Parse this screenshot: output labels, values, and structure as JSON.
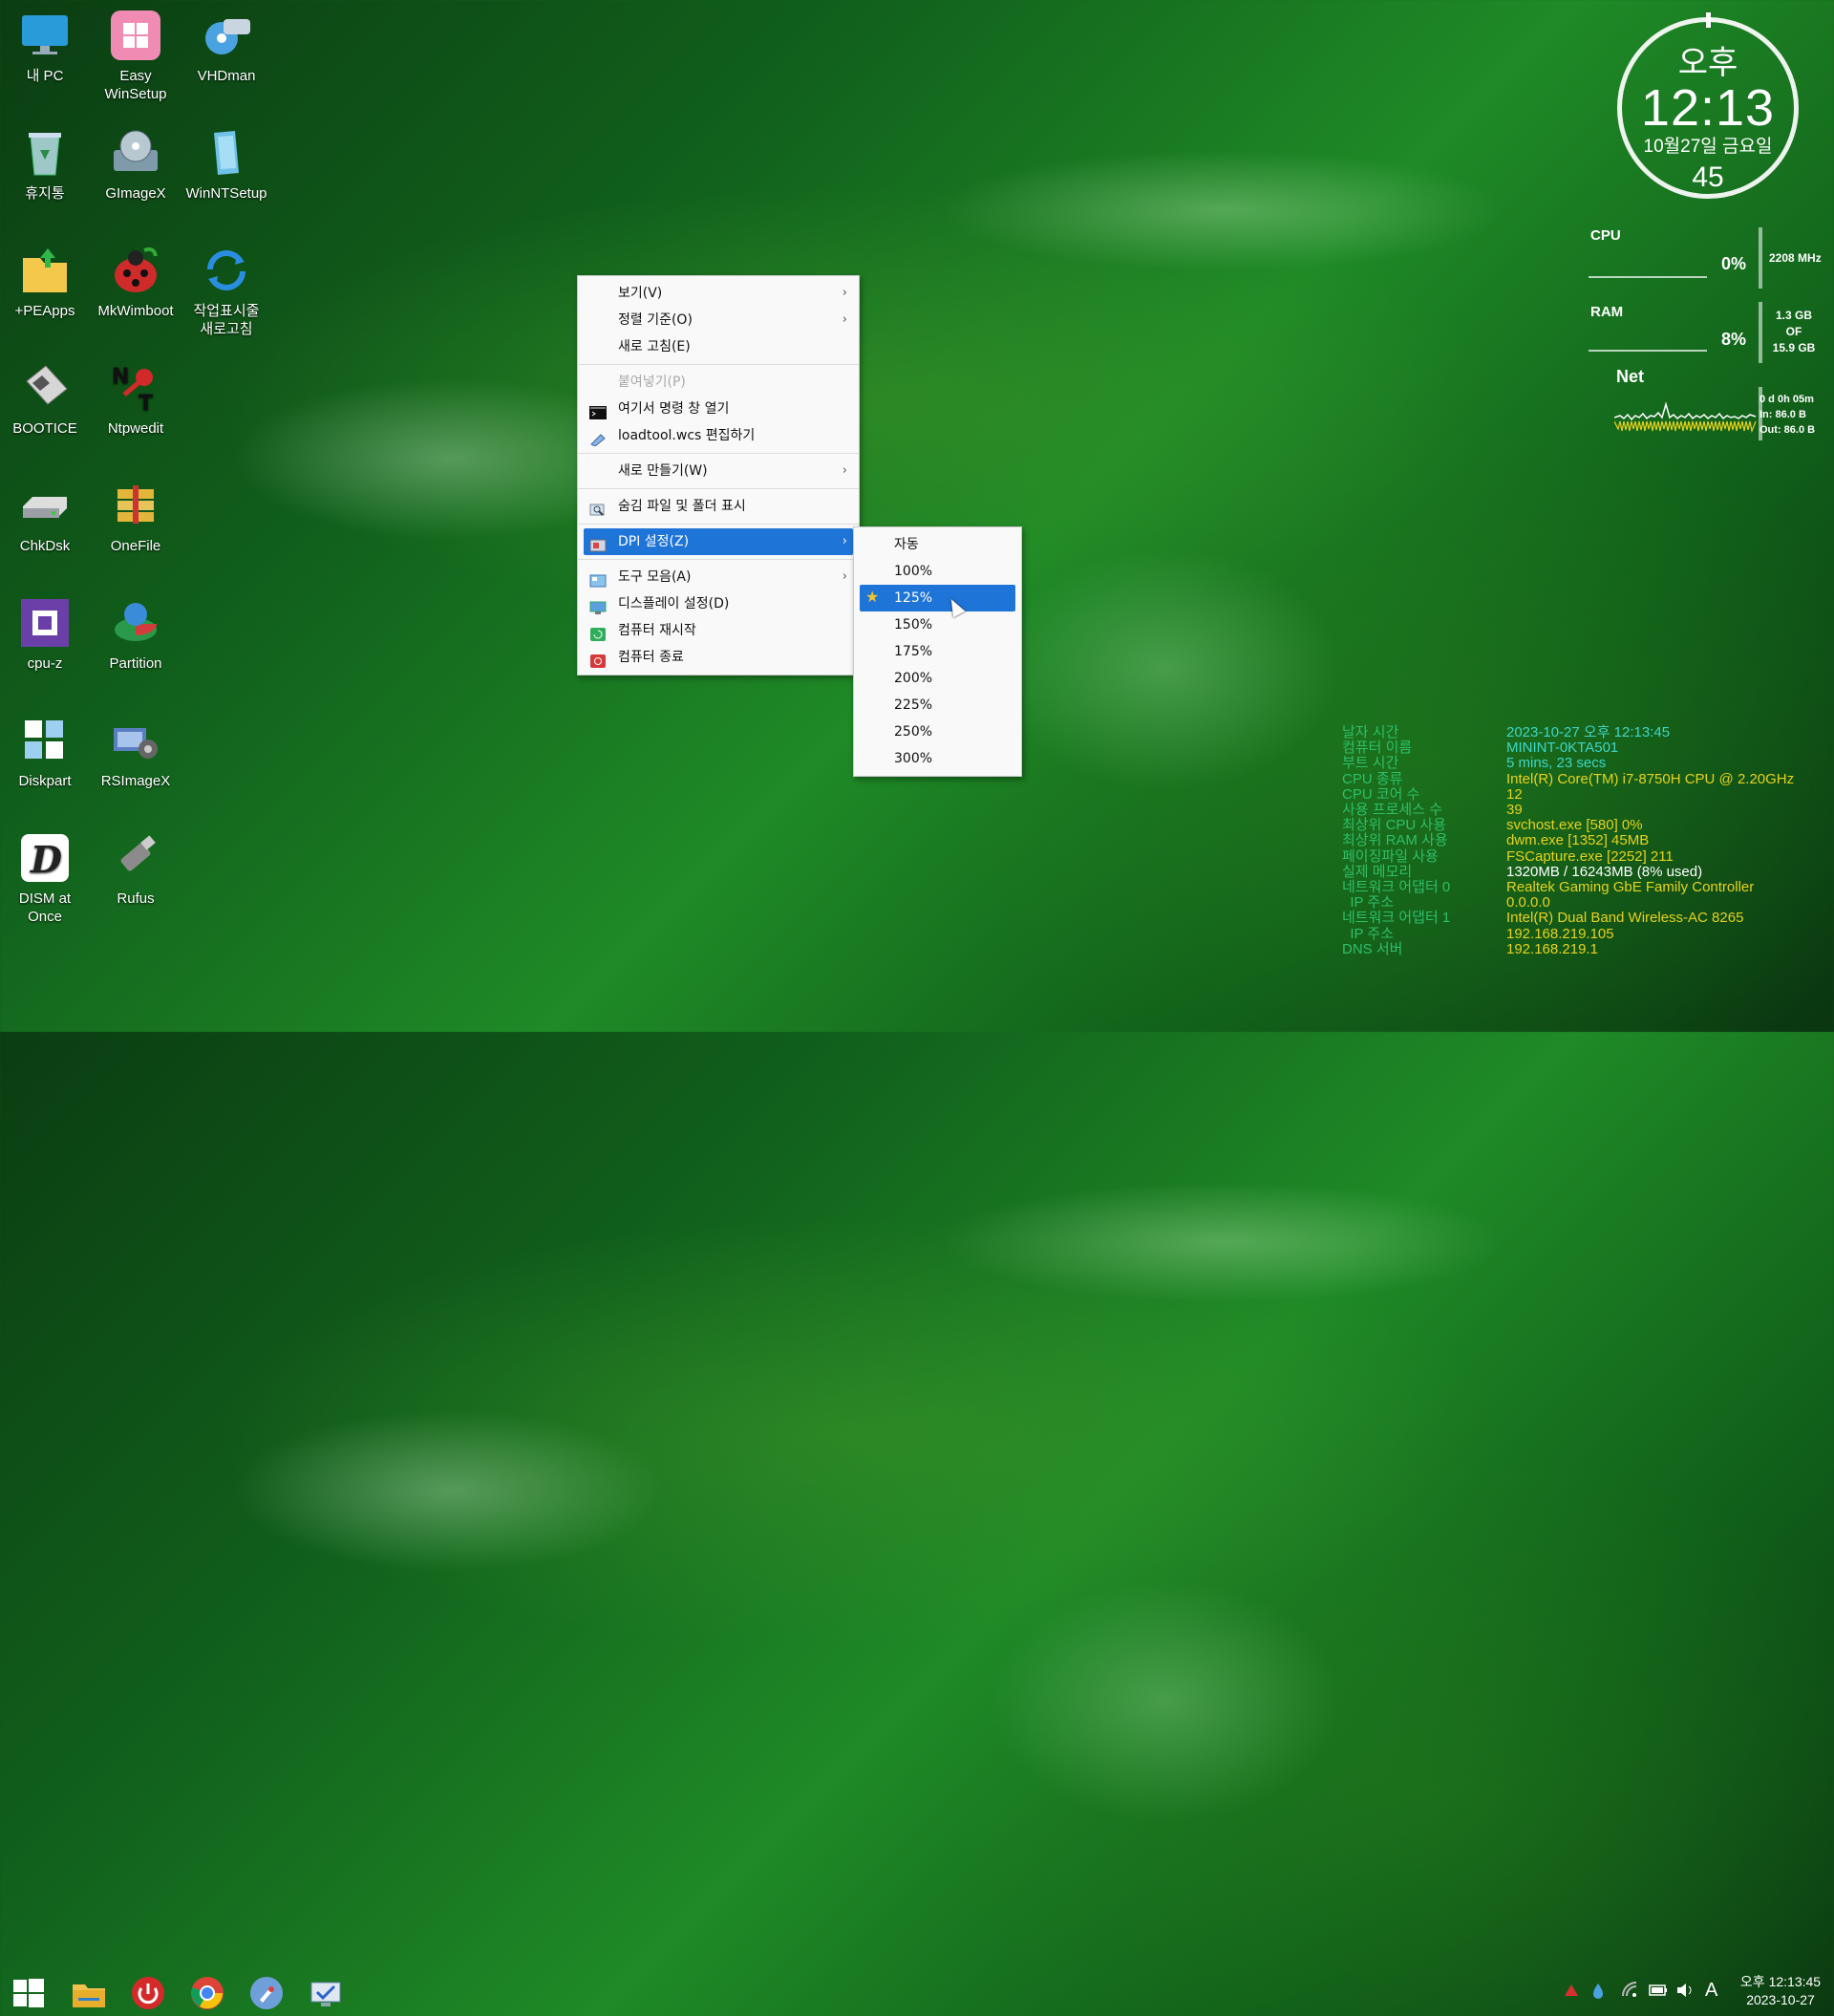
{
  "desktop_icons": [
    {
      "label": "내 PC",
      "icon": "monitor-icon",
      "color": "#2a9bd9"
    },
    {
      "label": "Easy\nWinSetup",
      "icon": "windows-pink-icon",
      "color": "#f08cb4"
    },
    {
      "label": "VHDman",
      "icon": "vhd-drive-icon",
      "color": "#4aa3e0"
    },
    {
      "label": "휴지통",
      "icon": "recycle-bin-icon",
      "color": "#9ec7c7"
    },
    {
      "label": "GImageX",
      "icon": "gimagex-icon",
      "color": "#7f9aa8"
    },
    {
      "label": "WinNTSetup",
      "icon": "winntsetup-icon",
      "color": "#6fc2e8"
    },
    {
      "label": "+PEApps",
      "icon": "folder-icon",
      "color": "#f3c84b"
    },
    {
      "label": "MkWimboot",
      "icon": "ladybug-icon",
      "color": "#cf2b2b"
    },
    {
      "label": "작업표시줄\n새로고침",
      "icon": "refresh-icon",
      "color": "#2a8ee0"
    },
    {
      "label": "BOOTICE",
      "icon": "floppy-icon",
      "color": "#d6d6d6"
    },
    {
      "label": "Ntpwedit",
      "icon": "key-icon",
      "color": "#d22a2a"
    },
    {
      "label": "ChkDsk",
      "icon": "disk-drive-icon",
      "color": "#9aa0a6"
    },
    {
      "label": "OneFile",
      "icon": "archive-icon",
      "color": "#e3b53a"
    },
    {
      "label": "cpu-z",
      "icon": "cpu-icon",
      "color": "#6b3fa8"
    },
    {
      "label": "Partition",
      "icon": "partition-icon",
      "color": "#d33c3c"
    },
    {
      "label": "Diskpart",
      "icon": "diskpart-icon",
      "color": "#ffffff"
    },
    {
      "label": "RSImageX",
      "icon": "rsimagex-icon",
      "color": "#5a7fc0"
    },
    {
      "label": "DISM at\nOnce",
      "icon": "dism-icon",
      "color": "#ffffff"
    },
    {
      "label": "Rufus",
      "icon": "usb-icon",
      "color": "#8b8b8b"
    }
  ],
  "clock": {
    "ampm": "오후",
    "time": "12:13",
    "date": "10월27일 금요일",
    "seconds": "45"
  },
  "meters": {
    "cpu": {
      "label": "CPU",
      "value": "0%",
      "extra": "2208 MHz"
    },
    "ram": {
      "label": "RAM",
      "value": "8%",
      "extra1": "1.3 GB",
      "extra2": "OF",
      "extra3": "15.9 GB"
    },
    "net": {
      "label": "Net",
      "uptime": "0 d 0h 05m",
      "in": "In: 86.0 B",
      "out": "Out: 86.0 B"
    }
  },
  "sysinfo": [
    {
      "key": "날자 시간",
      "value": "2023-10-27 오후 12:13:45",
      "tone": "cyan"
    },
    {
      "key": "컴퓨터 이름",
      "value": "MININT-0KTA501",
      "tone": "cyan"
    },
    {
      "key": "부트 시간",
      "value": "5 mins, 23 secs",
      "tone": "cyan"
    },
    {
      "key": "CPU 종류",
      "value": "Intel(R) Core(TM) i7-8750H CPU @ 2.20GHz",
      "tone": "yellow"
    },
    {
      "key": "CPU 코어 수",
      "value": "12",
      "tone": "yellow"
    },
    {
      "key": "사용 프로세스 수",
      "value": "39",
      "tone": "yellow"
    },
    {
      "key": "최상위 CPU 사용",
      "value": "svchost.exe [580] 0%",
      "tone": "yellow"
    },
    {
      "key": "최상위 RAM 사용",
      "value": "dwm.exe [1352] 45MB",
      "tone": "yellow"
    },
    {
      "key": "페이징파일 사용",
      "value": "FSCapture.exe [2252] 211",
      "tone": "yellow"
    },
    {
      "key": "실제 메모리",
      "value": "1320MB / 16243MB (8% used)",
      "tone": "white"
    },
    {
      "key": "네트워크 어댑터 0",
      "value": "Realtek Gaming GbE Family Controller",
      "tone": "yellow"
    },
    {
      "key": "  IP 주소",
      "value": "0.0.0.0",
      "tone": "yellow"
    },
    {
      "key": "네트워크 어댑터 1",
      "value": "Intel(R) Dual Band Wireless-AC 8265",
      "tone": "yellow"
    },
    {
      "key": "  IP 주소",
      "value": "192.168.219.105",
      "tone": "yellow"
    },
    {
      "key": "DNS 서버",
      "value": "192.168.219.1",
      "tone": "yellow"
    }
  ],
  "context_menu": {
    "items": [
      {
        "label": "보기(V)",
        "submenu": true
      },
      {
        "label": "정렬 기준(O)",
        "submenu": true
      },
      {
        "label": "새로 고침(E)"
      },
      {
        "sep": true
      },
      {
        "label": "붙여넣기(P)",
        "disabled": true
      },
      {
        "label": "여기서 명령 창 열기",
        "icon": "cmd-icon"
      },
      {
        "label": "loadtool.wcs 편집하기",
        "icon": "script-icon"
      },
      {
        "sep": true
      },
      {
        "label": "새로 만들기(W)",
        "submenu": true
      },
      {
        "sep": true
      },
      {
        "label": "숨김 파일 및 폴더 표시",
        "icon": "search-folder-icon"
      },
      {
        "sep": true
      },
      {
        "label": "DPI 설정(Z)",
        "submenu": true,
        "highlight": true,
        "icon": "dpi-icon"
      },
      {
        "sep": true
      },
      {
        "label": "도구 모음(A)",
        "submenu": true,
        "icon": "toolbar-icon"
      },
      {
        "label": "디스플레이 설정(D)",
        "icon": "display-icon"
      },
      {
        "label": "컴퓨터 재시작",
        "icon": "restart-icon"
      },
      {
        "label": "컴퓨터 종료",
        "icon": "shutdown-icon"
      }
    ]
  },
  "dpi_submenu": {
    "items": [
      "자동",
      "100%",
      "125%",
      "150%",
      "175%",
      "200%",
      "225%",
      "250%",
      "300%"
    ],
    "selected": "125%"
  },
  "taskbar": {
    "clock_time": "오후 12:13:45",
    "clock_date": "2023-10-27",
    "ime": "A"
  },
  "colors": {
    "menu_highlight": "#1f74d8",
    "info_key": "#2fbf6a",
    "info_value": "#e8d21c"
  }
}
